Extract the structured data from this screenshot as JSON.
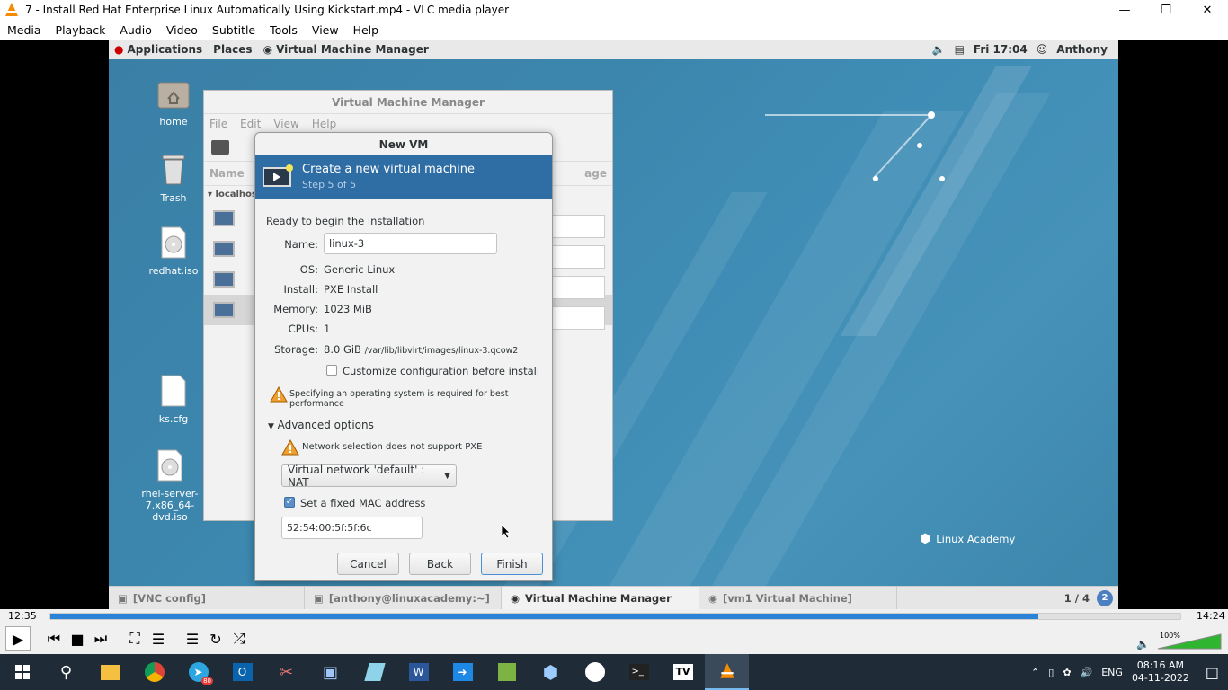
{
  "window": {
    "title": "7 - Install Red Hat Enterprise Linux Automatically Using Kickstart.mp4 - VLC media player"
  },
  "menu": [
    "Media",
    "Playback",
    "Audio",
    "Video",
    "Subtitle",
    "Tools",
    "View",
    "Help"
  ],
  "gnome_top": {
    "applications": "Applications",
    "places": "Places",
    "app": "Virtual Machine Manager",
    "clock": "Fri 17:04",
    "user": "Anthony"
  },
  "desktop": [
    {
      "label": "home"
    },
    {
      "label": "Trash"
    },
    {
      "label": "redhat.iso"
    },
    {
      "label": "ks.cfg"
    },
    {
      "label": "rhel-server-7.x86_64-dvd.iso"
    }
  ],
  "bgwin": {
    "title": "Virtual Machine Manager",
    "menu": [
      "File",
      "Edit",
      "View",
      "Help"
    ],
    "col_name": "Name",
    "col_usage": "age",
    "host": "localhost"
  },
  "dialog": {
    "title": "New VM",
    "heading": "Create a new virtual machine",
    "step": "Step 5 of 5",
    "ready": "Ready to begin the installation",
    "name_label": "Name:",
    "name_value": "linux-3",
    "os_label": "OS:",
    "os_value": "Generic Linux",
    "install_label": "Install:",
    "install_value": "PXE Install",
    "memory_label": "Memory:",
    "memory_value": "1023 MiB",
    "cpus_label": "CPUs:",
    "cpus_value": "1",
    "storage_label": "Storage:",
    "storage_value": "8.0 GiB",
    "storage_path": "/var/lib/libvirt/images/linux-3.qcow2",
    "customize": "Customize configuration before install",
    "os_warning": "Specifying an operating system is required for best performance",
    "advanced": "Advanced options",
    "net_warning": "Network selection does not support PXE",
    "network": "Virtual network 'default' : NAT",
    "fixed_mac": "Set a fixed MAC address",
    "mac": "52:54:00:5f:5f:6c",
    "cancel": "Cancel",
    "back": "Back",
    "finish": "Finish"
  },
  "watermark": "Linux Academy",
  "gnome_bottom": {
    "tasks": [
      "[VNC config]",
      "[anthony@linuxacademy:~]",
      "Virtual Machine Manager",
      "[vm1 Virtual Machine]"
    ],
    "workspace": "1 / 4"
  },
  "player": {
    "elapsed": "12:35",
    "total": "14:24",
    "progress": 0.874,
    "volume": "100%"
  },
  "tray": {
    "lang": "ENG",
    "time": "08:16 AM",
    "date": "04-11-2022",
    "badge": "80"
  }
}
